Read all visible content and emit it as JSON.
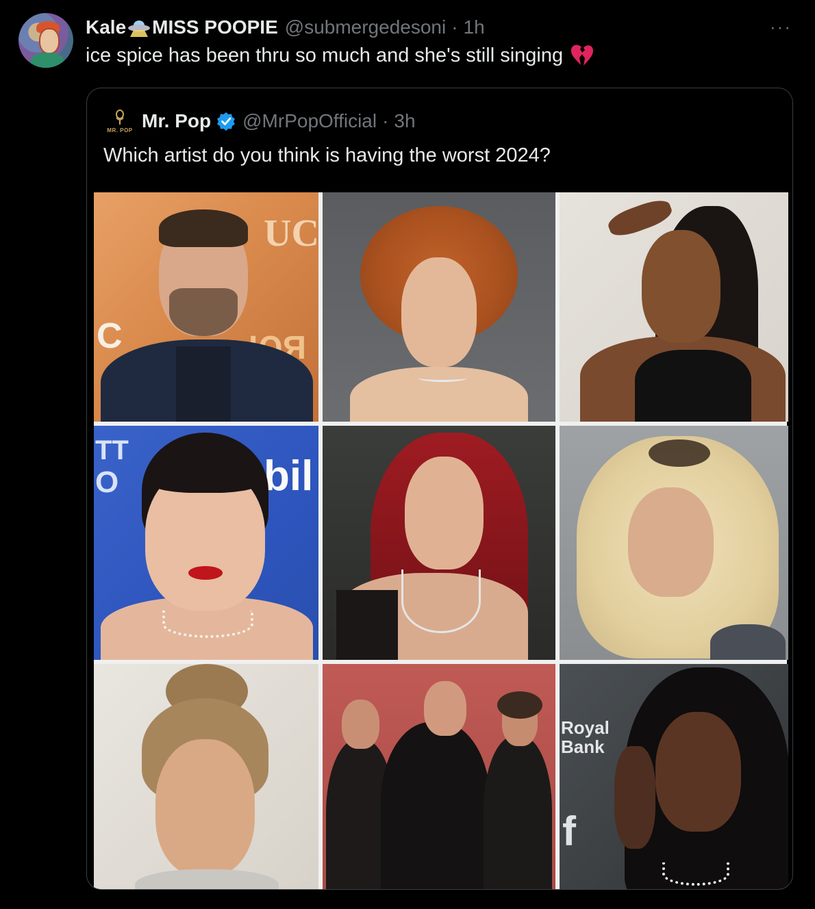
{
  "tweet": {
    "display_name_part1": "Kale",
    "display_name_part2": "MISS POOPIE",
    "handle": "@submergedesoni",
    "separator": "·",
    "time": "1h",
    "more": "···",
    "text": "ice spice has been thru so much and she's still singing",
    "emoji_name": "broken-heart-icon",
    "name_emoji_name": "ufo-icon"
  },
  "quoted": {
    "display_name": "Mr. Pop",
    "verified": true,
    "handle": "@MrPopOfficial",
    "separator": "·",
    "time": "3h",
    "avatar_text": "MR. POP",
    "text": "Which artist do you think is having the worst 2024?"
  },
  "photo_signs": {
    "cell1_a": "UC",
    "cell1_b": "C",
    "cell1_c": "ЮЯ",
    "cell4_a": "TT",
    "cell4_b": "O",
    "cell4_c": "bil",
    "cell9_a": "Royal",
    "cell9_b": "Bank",
    "cell9_c": "f"
  },
  "colors": {
    "background": "#000000",
    "text": "#e7e9ea",
    "secondary": "#71767b",
    "border": "#3a3e42",
    "verified": "#1d9bf0",
    "heart": "#e0245e"
  }
}
